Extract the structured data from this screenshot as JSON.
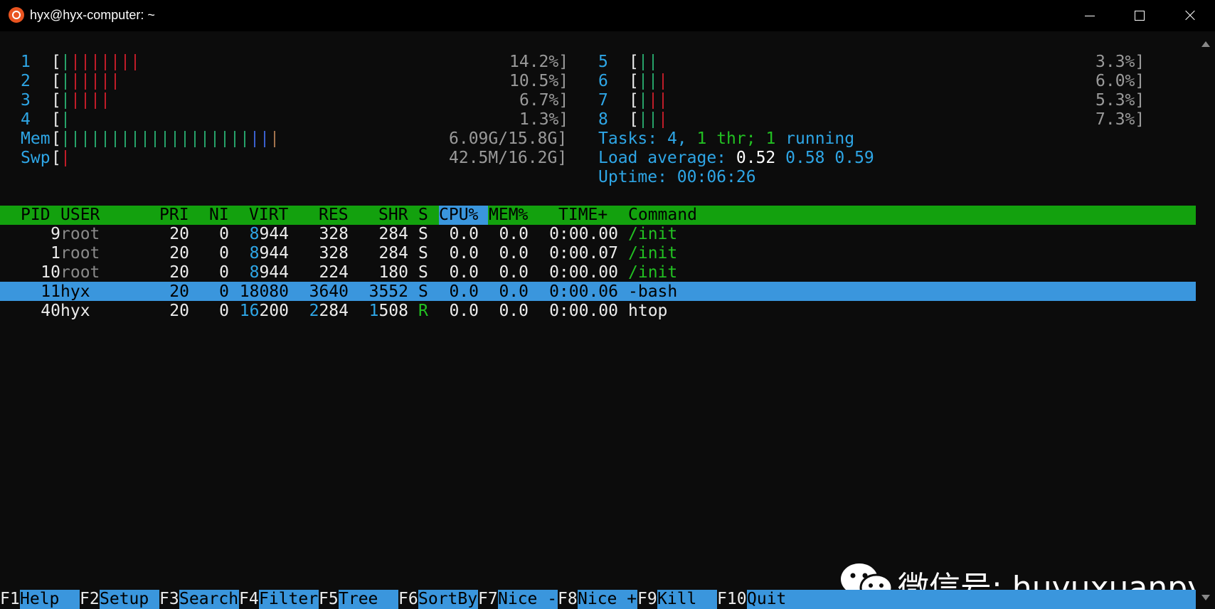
{
  "window": {
    "title": "hyx@hyx-computer: ~",
    "app_icon": "ubuntu-icon",
    "controls": [
      "minimize-icon",
      "maximize-icon",
      "close-icon"
    ]
  },
  "meters": {
    "cpus_left": [
      {
        "id": "1",
        "value": "14.2%]"
      },
      {
        "id": "2",
        "value": "10.5%]"
      },
      {
        "id": "3",
        "value": "6.7%]"
      },
      {
        "id": "4",
        "value": "1.3%]"
      }
    ],
    "cpus_right": [
      {
        "id": "5",
        "value": "3.3%]"
      },
      {
        "id": "6",
        "value": "6.0%]"
      },
      {
        "id": "7",
        "value": "5.3%]"
      },
      {
        "id": "8",
        "value": "7.3%]"
      }
    ],
    "bracket": "[",
    "mem": {
      "label": "Mem",
      "value": "6.09G/15.8G]"
    },
    "swp": {
      "label": "Swp",
      "value": "42.5M/16.2G]"
    }
  },
  "summary": {
    "tasks_label": "Tasks: ",
    "tasks_count": "4",
    "tasks_sep": ", ",
    "threads": "1",
    "thr_label": " thr; ",
    "running": "1",
    "running_label": " running",
    "load_label": "Load average: ",
    "load1": "0.52",
    "load5": "0.58",
    "load15": "0.59",
    "uptime_label": "Uptime: ",
    "uptime": "00:06:26"
  },
  "table": {
    "columns": {
      "pid": "PID",
      "user": "USER",
      "pri": "PRI",
      "ni": "NI",
      "virt": "VIRT",
      "res": "RES",
      "shr": "SHR",
      "s": "S",
      "cpu": "CPU%",
      "mem": "MEM%",
      "time": "TIME+",
      "command": "Command"
    },
    "rows": [
      {
        "pid": "9",
        "user": "root",
        "pri": "20",
        "ni": "0",
        "virt_hi": "8",
        "virt_lo": "944",
        "res_hi": "",
        "res_lo": "328",
        "shr_hi": "",
        "shr_lo": "284",
        "s": "S",
        "cpu": "0.0",
        "mem": "0.0",
        "time": "0:00.00",
        "command": "/init"
      },
      {
        "pid": "1",
        "user": "root",
        "pri": "20",
        "ni": "0",
        "virt_hi": "8",
        "virt_lo": "944",
        "res_hi": "",
        "res_lo": "328",
        "shr_hi": "",
        "shr_lo": "284",
        "s": "S",
        "cpu": "0.0",
        "mem": "0.0",
        "time": "0:00.07",
        "command": "/init"
      },
      {
        "pid": "10",
        "user": "root",
        "pri": "20",
        "ni": "0",
        "virt_hi": "8",
        "virt_lo": "944",
        "res_hi": "",
        "res_lo": "224",
        "shr_hi": "",
        "shr_lo": "180",
        "s": "S",
        "cpu": "0.0",
        "mem": "0.0",
        "time": "0:00.00",
        "command": "/init"
      },
      {
        "pid": "11",
        "user": "hyx",
        "pri": "20",
        "ni": "0",
        "virt_hi": "18",
        "virt_lo": "080",
        "res_hi": "3",
        "res_lo": "640",
        "shr_hi": "3",
        "shr_lo": "552",
        "s": "S",
        "cpu": "0.0",
        "mem": "0.0",
        "time": "0:00.06",
        "command": "-bash"
      },
      {
        "pid": "40",
        "user": "hyx",
        "pri": "20",
        "ni": "0",
        "virt_hi": "16",
        "virt_lo": "200",
        "res_hi": "2",
        "res_lo": "284",
        "shr_hi": "1",
        "shr_lo": "508",
        "s": "R",
        "cpu": "0.0",
        "mem": "0.0",
        "time": "0:00.00",
        "command": "htop"
      }
    ]
  },
  "function_keys": [
    {
      "key": "F1",
      "label": "Help  "
    },
    {
      "key": "F2",
      "label": "Setup "
    },
    {
      "key": "F3",
      "label": "Search"
    },
    {
      "key": "F4",
      "label": "Filter"
    },
    {
      "key": "F5",
      "label": "Tree  "
    },
    {
      "key": "F6",
      "label": "SortBy"
    },
    {
      "key": "F7",
      "label": "Nice -"
    },
    {
      "key": "F8",
      "label": "Nice +"
    },
    {
      "key": "F9",
      "label": "Kill  "
    },
    {
      "key": "F10",
      "label": "Quit"
    }
  ],
  "watermark": {
    "icon": "wechat-icon",
    "text": "微信号: huyuxuanpy"
  },
  "colors": {
    "header_green": "#13a10e",
    "selection_blue": "#3a96dd",
    "cyan": "#2ea6e6",
    "tick_red": "#c01c28",
    "tick_green": "#26a269",
    "tick_blue": "#3a5fcd",
    "tick_amber": "#a2734c"
  }
}
